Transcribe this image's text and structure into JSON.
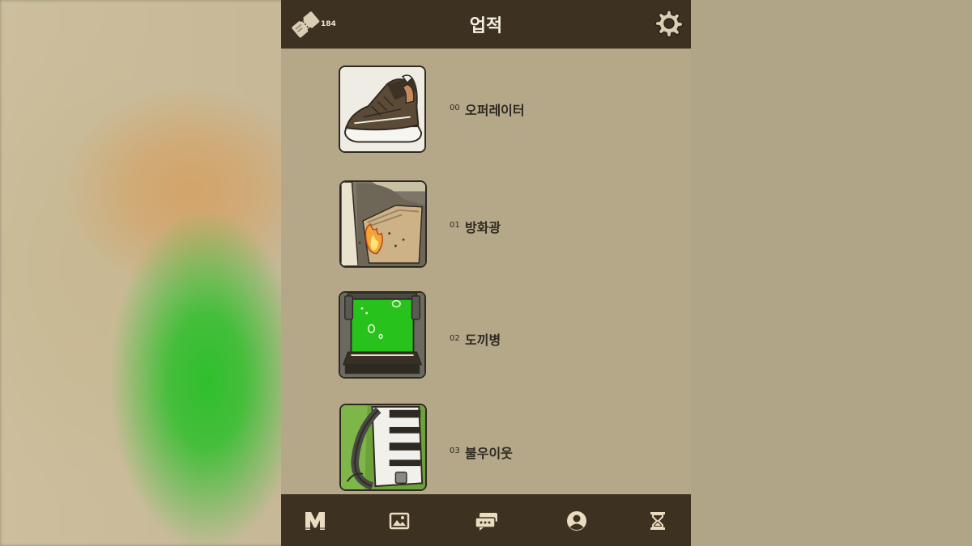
{
  "header": {
    "title": "업적",
    "ticket_count": "184",
    "ticket_icon": "ticket-icon",
    "settings_icon": "gear-icon"
  },
  "achievements": [
    {
      "number": "00",
      "name": "오퍼레이터",
      "icon": "sneaker-image"
    },
    {
      "number": "01",
      "name": "방화광",
      "icon": "burning-paper-image"
    },
    {
      "number": "02",
      "name": "도끼병",
      "icon": "green-capsule-image"
    },
    {
      "number": "03",
      "name": "불우이웃",
      "icon": "backpack-image"
    }
  ],
  "bottom_nav": [
    {
      "icon": "m-logo-icon"
    },
    {
      "icon": "gallery-icon"
    },
    {
      "icon": "chat-icon"
    },
    {
      "icon": "profile-icon"
    },
    {
      "icon": "hourglass-icon"
    }
  ],
  "colors": {
    "bar": "#3d3222",
    "panel": "#b5a889",
    "nav_icon": "#e9dcc0",
    "capsule_green": "#27c21c"
  }
}
